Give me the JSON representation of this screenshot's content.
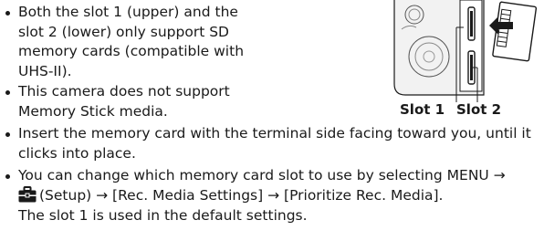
{
  "bullets": [
    {
      "lines": [
        "Both the slot 1 (upper) and the",
        "slot 2 (lower) only support SD",
        "memory cards (compatible with",
        "UHS-II)."
      ]
    },
    {
      "lines": [
        "This camera does not support",
        "Memory Stick media."
      ]
    },
    {
      "lines": [
        "Insert the memory card with the terminal side facing toward you, until it",
        "clicks into place."
      ]
    },
    {
      "line1": "You can change which memory card slot to use by selecting MENU →",
      "line2": "(Setup) → [Rec. Media Settings] → [Prioritize Rec. Media]."
    }
  ],
  "note": "The slot 1 is used in the default settings.",
  "figure": {
    "slot1_label": "Slot 1",
    "slot2_label": "Slot 2",
    "icons": [
      "toolbox-icon",
      "arrow-icon",
      "sd-card-icon",
      "camera-body-icon"
    ]
  }
}
